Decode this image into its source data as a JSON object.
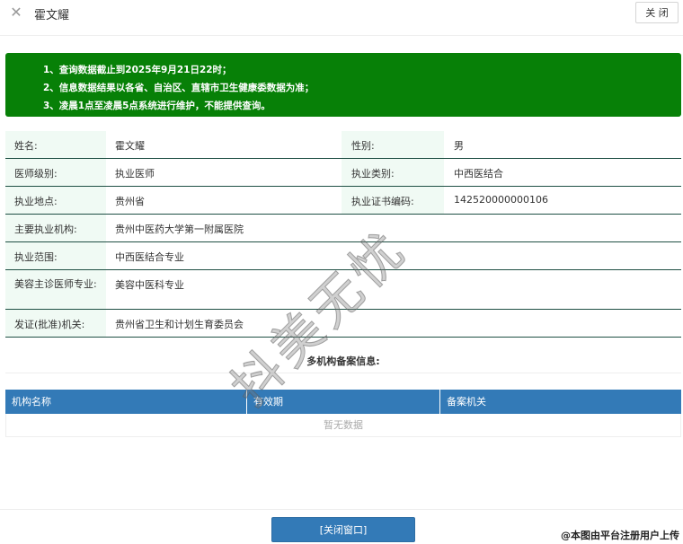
{
  "window": {
    "close_icon": "close-icon",
    "title": "霍文耀",
    "close_button": "关 闭"
  },
  "notice": [
    "1、查询数据截止到2025年9月21日22时；",
    "2、信息数据结果以各省、自治区、直辖市卫生健康委数据为准；",
    "3、凌晨1点至凌晨5点系统进行维护，不能提供查询。"
  ],
  "notice_color": "#078007",
  "info": {
    "name_label": "姓名:",
    "name_value": "霍文耀",
    "gender_label": "性别:",
    "gender_value": "男",
    "level_label": "医师级别:",
    "level_value": "执业医师",
    "category_label": "执业类别:",
    "category_value": "中西医结合",
    "place_label": "执业地点:",
    "place_value": "贵州省",
    "cert_label": "执业证书编码:",
    "cert_value": "142520000000106",
    "institution_label": "主要执业机构:",
    "institution_value": "贵州中医药大学第一附属医院",
    "scope_label": "执业范围:",
    "scope_value": "中西医结合专业",
    "beauty_label": "美容主诊医师专业:",
    "beauty_value": "美容中医科专业",
    "authority_label": "发证(批准)机关:",
    "authority_value": "贵州省卫生和计划生育委员会"
  },
  "multi": {
    "title": "多机构备案信息:",
    "columns": [
      "机构名称",
      "有效期",
      "备案机关"
    ],
    "empty_text": "暂无数据"
  },
  "footer": {
    "close_window": "[关闭窗口]"
  },
  "watermark": "抖美无忧",
  "credit": "@本图由平台注册用户上传"
}
